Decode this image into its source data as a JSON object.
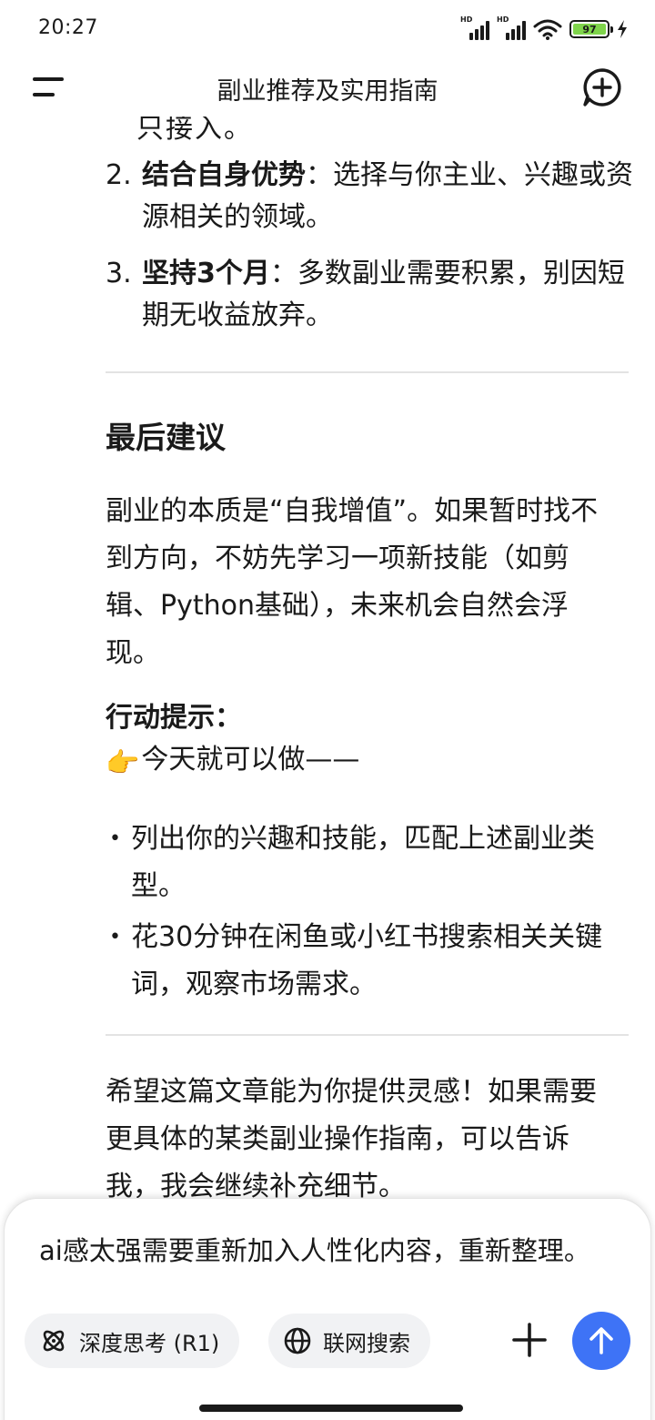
{
  "status_bar": {
    "time": "20:27",
    "signal_1_label": "HD",
    "signal_2_label": "HD",
    "battery_level": "97",
    "battery_color": "#7fd44b"
  },
  "header": {
    "title": "副业推荐及实用指南",
    "menu_icon": "menu-icon",
    "new_chat_icon": "new-chat-plus-icon"
  },
  "content": {
    "cut_line": "只接入。",
    "numbered_items": [
      {
        "num": "2.",
        "bold": "结合自身优势",
        "text": "：选择与你主业、兴趣或资源相关的领域。"
      },
      {
        "num": "3.",
        "bold": "坚持3个月",
        "text": "：多数副业需要积累，别因短期无收益放弃。"
      }
    ],
    "final_heading": "最后建议",
    "final_paragraph": "副业的本质是“自我增值”。如果暂时找不到方向，不妨先学习一项新技能（如剪辑、Python基础），未来机会自然会浮现。",
    "action_title": "行动提示：",
    "action_emoji": "👉",
    "action_line": "今天就可以做——",
    "bullets": [
      "列出你的兴趣和技能，匹配上述副业类型。",
      "花30分钟在闲鱼或小红书搜索相关关键词，观察市场需求。"
    ],
    "closing": "希望这篇文章能为你提供灵感！如果需要更具体的某类副业操作指南，可以告诉我，我会继续补充细节。"
  },
  "input_panel": {
    "input_value": "ai感太强需要重新加入人性化内容，重新整理。",
    "deep_think_label": "深度思考 (R1)",
    "web_search_label": "联网搜索",
    "accent_color": "#3e73f6"
  }
}
